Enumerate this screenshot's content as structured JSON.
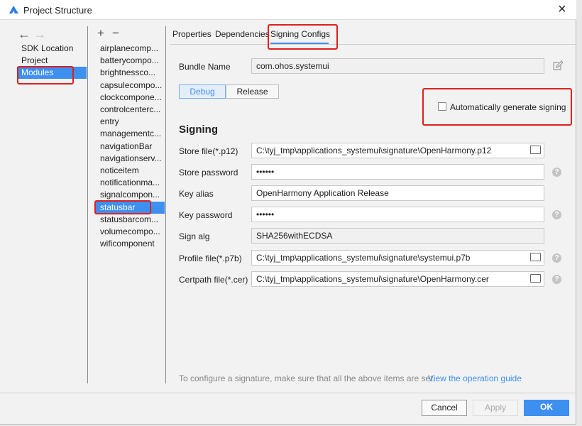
{
  "window": {
    "title": "Project Structure",
    "close_icon": "×"
  },
  "nav": {
    "back_icon": "←",
    "forward_icon": "→",
    "items": [
      "SDK Location",
      "Project",
      "Modules"
    ],
    "selected": "Modules"
  },
  "modules": {
    "add_icon": "+",
    "remove_icon": "−",
    "items": [
      "airplanecomp...",
      "batterycompo...",
      "brightnessco...",
      "capsulecompo...",
      "clockcompone...",
      "controlcenterc...",
      "entry",
      "managementc...",
      "navigationBar",
      "navigationserv...",
      "noticeitem",
      "notificationma...",
      "signalcompon...",
      "statusbar",
      "statusbarcom...",
      "volumecompo...",
      "wificomponent"
    ],
    "selected": "statusbar"
  },
  "tabs": {
    "items": [
      "Properties",
      "Dependencies",
      "Signing Configs"
    ],
    "active": "Signing Configs"
  },
  "bundle": {
    "label": "Bundle Name",
    "value": "com.ohos.systemui"
  },
  "build_type": {
    "debug": "Debug",
    "release": "Release",
    "active": "Debug"
  },
  "auto_sign": {
    "label": "Automatically generate signing",
    "checked": false
  },
  "signing": {
    "title": "Signing",
    "fields": [
      {
        "label": "Store file(*.p12)",
        "value": "C:\\tyj_tmp\\applications_systemui\\signature\\OpenHarmony.p12"
      },
      {
        "label": "Store password",
        "value": "••••••"
      },
      {
        "label": "Key alias",
        "value": "OpenHarmony Application Release"
      },
      {
        "label": "Key password",
        "value": "••••••"
      },
      {
        "label": "Sign alg",
        "value": "SHA256withECDSA"
      },
      {
        "label": "Profile file(*.p7b)",
        "value": "C:\\tyj_tmp\\applications_systemui\\signature\\systemui.p7b"
      },
      {
        "label": "Certpath file(*.cer)",
        "value": "C:\\tyj_tmp\\applications_systemui\\signature\\OpenHarmony.cer"
      }
    ]
  },
  "footer": {
    "hint": "To configure a signature, make sure that all the above items are set.",
    "link": "View the operation guide"
  },
  "buttons": {
    "cancel": "Cancel",
    "apply": "Apply",
    "ok": "OK"
  },
  "colors": {
    "accent": "#3d8ff0",
    "highlight": "#e0201e"
  }
}
